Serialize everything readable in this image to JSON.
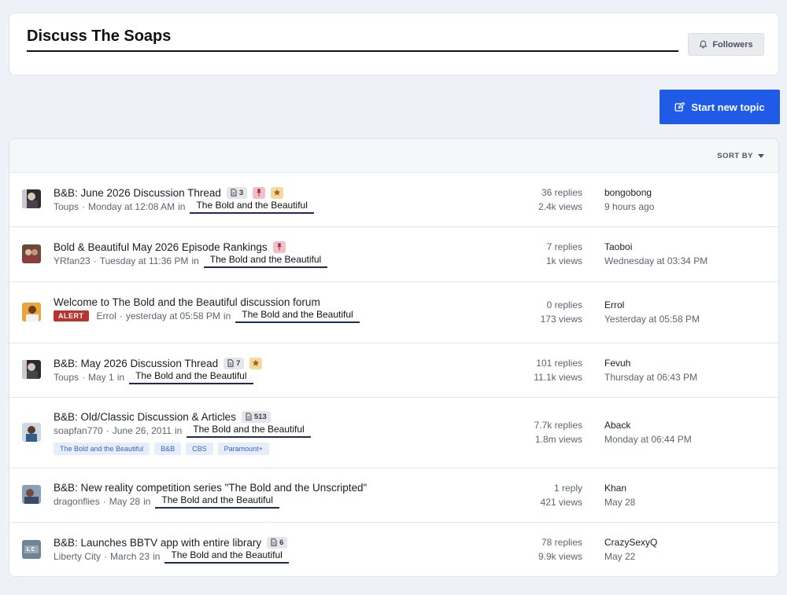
{
  "header": {
    "title": "Discuss The Soaps",
    "followers_label": "Followers"
  },
  "actions": {
    "start_topic_label": "Start new topic"
  },
  "list": {
    "sort_label": "SORT BY",
    "topics": [
      {
        "title": "B&B: June 2026 Discussion Thread",
        "pages": "3",
        "pinned": true,
        "featured": true,
        "author": "Toups",
        "started": "Monday at 12:08 AM",
        "in": "in",
        "forum": "The Bold and the Beautiful",
        "replies": "36 replies",
        "views": "2.4k views",
        "last_user": "bongobong",
        "last_time": "9 hours ago"
      },
      {
        "title": "Bold & Beautiful May 2026 Episode Rankings",
        "pinned": true,
        "author": "YRfan23",
        "started": "Tuesday at 11:36 PM",
        "in": "in",
        "forum": "The Bold and the Beautiful",
        "replies": "7 replies",
        "views": "1k views",
        "last_user": "Taoboi",
        "last_time": "Wednesday at 03:34 PM"
      },
      {
        "title": "Welcome to The Bold and the Beautiful discussion forum",
        "alert": "ALERT",
        "author": "Errol",
        "started": "yesterday at 05:58 PM",
        "in": "in",
        "forum": "The Bold and the Beautiful",
        "replies": "0 replies",
        "views": "173 views",
        "last_user": "Errol",
        "last_time": "Yesterday at 05:58 PM"
      },
      {
        "title": "B&B: May 2026 Discussion Thread",
        "pages": "7",
        "featured": true,
        "author": "Toups",
        "started": "May 1",
        "in": "in",
        "forum": "The Bold and the Beautiful",
        "replies": "101 replies",
        "views": "11.1k views",
        "last_user": "Fevuh",
        "last_time": "Thursday at 06:43 PM"
      },
      {
        "title": "B&B: Old/Classic Discussion & Articles",
        "pages": "513",
        "author": "soapfan770",
        "started": "June 26, 2011",
        "in": "in",
        "forum": "The Bold and the Beautiful",
        "tags": [
          "The Bold and the Beautiful",
          "B&B",
          "CBS",
          "Paramount+"
        ],
        "replies": "7.7k replies",
        "views": "1.8m views",
        "last_user": "Aback",
        "last_time": "Monday at 06:44 PM"
      },
      {
        "title": "B&B: New reality competition series \"The Bold and the Unscripted\"",
        "author": "dragonflies",
        "started": "May 28",
        "in": "in",
        "forum": "The Bold and the Beautiful",
        "replies": "1 reply",
        "views": "421 views",
        "last_user": "Khan",
        "last_time": "May 28"
      },
      {
        "title": "B&B: Launches BBTV app with entire library",
        "pages": "6",
        "author": "Liberty City",
        "started": "March 23",
        "in": "in",
        "forum": "The Bold and the Beautiful",
        "replies": "78 replies",
        "views": "9.9k views",
        "last_user": "CrazySexyQ",
        "last_time": "May 22"
      }
    ]
  },
  "colors": {
    "accent": "#1f5be6",
    "alert": "#b8322e",
    "pin": "#f2bfc9",
    "star": "#f5d9a0",
    "forum_underline": "#1d2a5a"
  },
  "icons": {
    "followers": "bell-icon",
    "start_topic": "edit-icon",
    "pages": "document-icon",
    "pinned": "pin-icon",
    "featured": "star-icon"
  }
}
